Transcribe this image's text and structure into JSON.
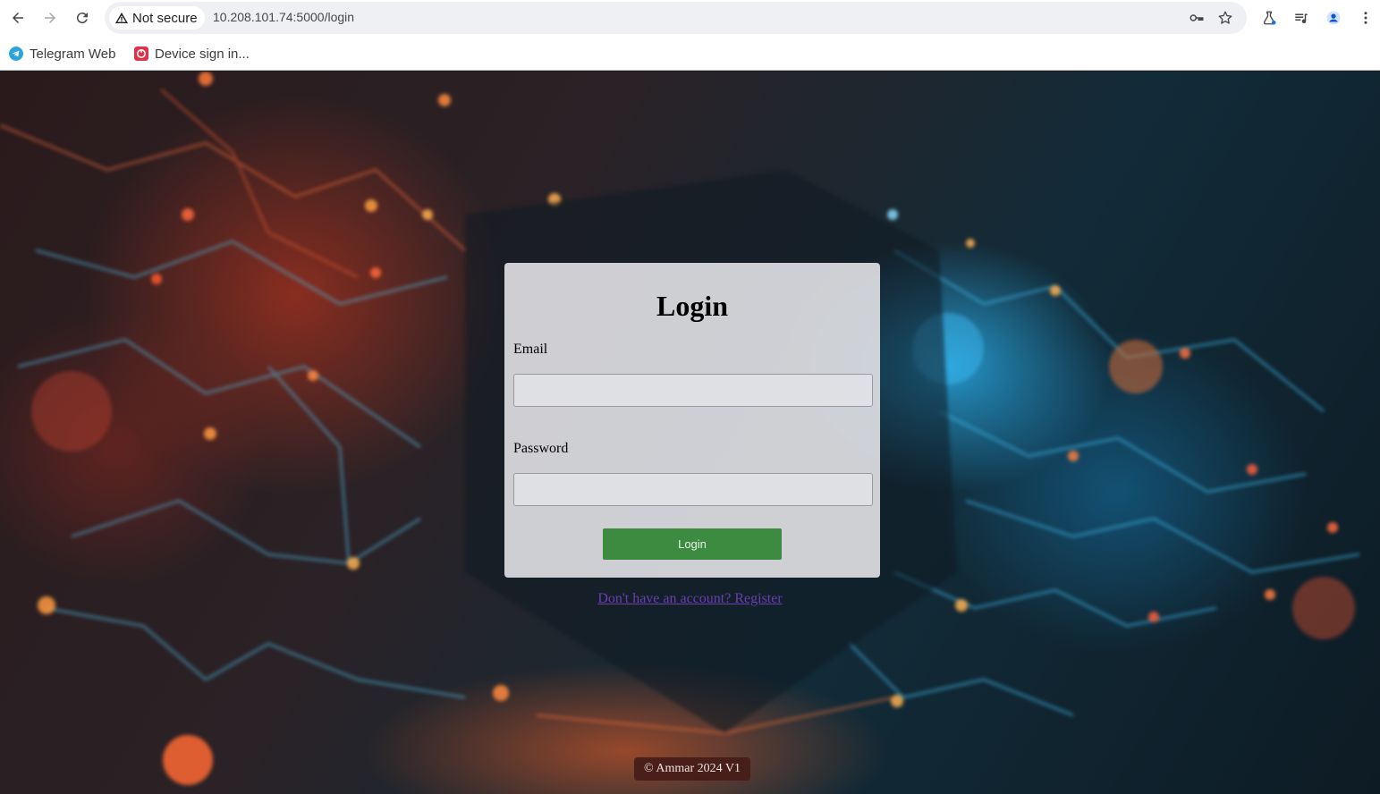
{
  "browser": {
    "security_label": "Not secure",
    "url": "10.208.101.74:5000/login",
    "icons": {
      "back": "arrow-left-icon",
      "forward": "arrow-right-icon",
      "reload": "reload-icon",
      "warning": "warning-triangle-icon",
      "password": "key-icon",
      "bookmark": "star-icon",
      "labs": "flask-icon",
      "media": "media-queue-icon",
      "profile": "profile-icon",
      "menu": "kebab-menu-icon"
    }
  },
  "bookmarks": [
    {
      "label": "Telegram Web",
      "icon": "telegram-icon",
      "color": "#2aa3df"
    },
    {
      "label": "Device sign in...",
      "icon": "device-signin-icon",
      "color": "#e0304a"
    }
  ],
  "login": {
    "title": "Login",
    "email_label": "Email",
    "email_value": "",
    "password_label": "Password",
    "password_value": "",
    "submit_label": "Login",
    "submit_color": "#3d8b40",
    "register_link": "Don't have an account? Register"
  },
  "footer": {
    "text": "© Ammar 2024 V1"
  }
}
